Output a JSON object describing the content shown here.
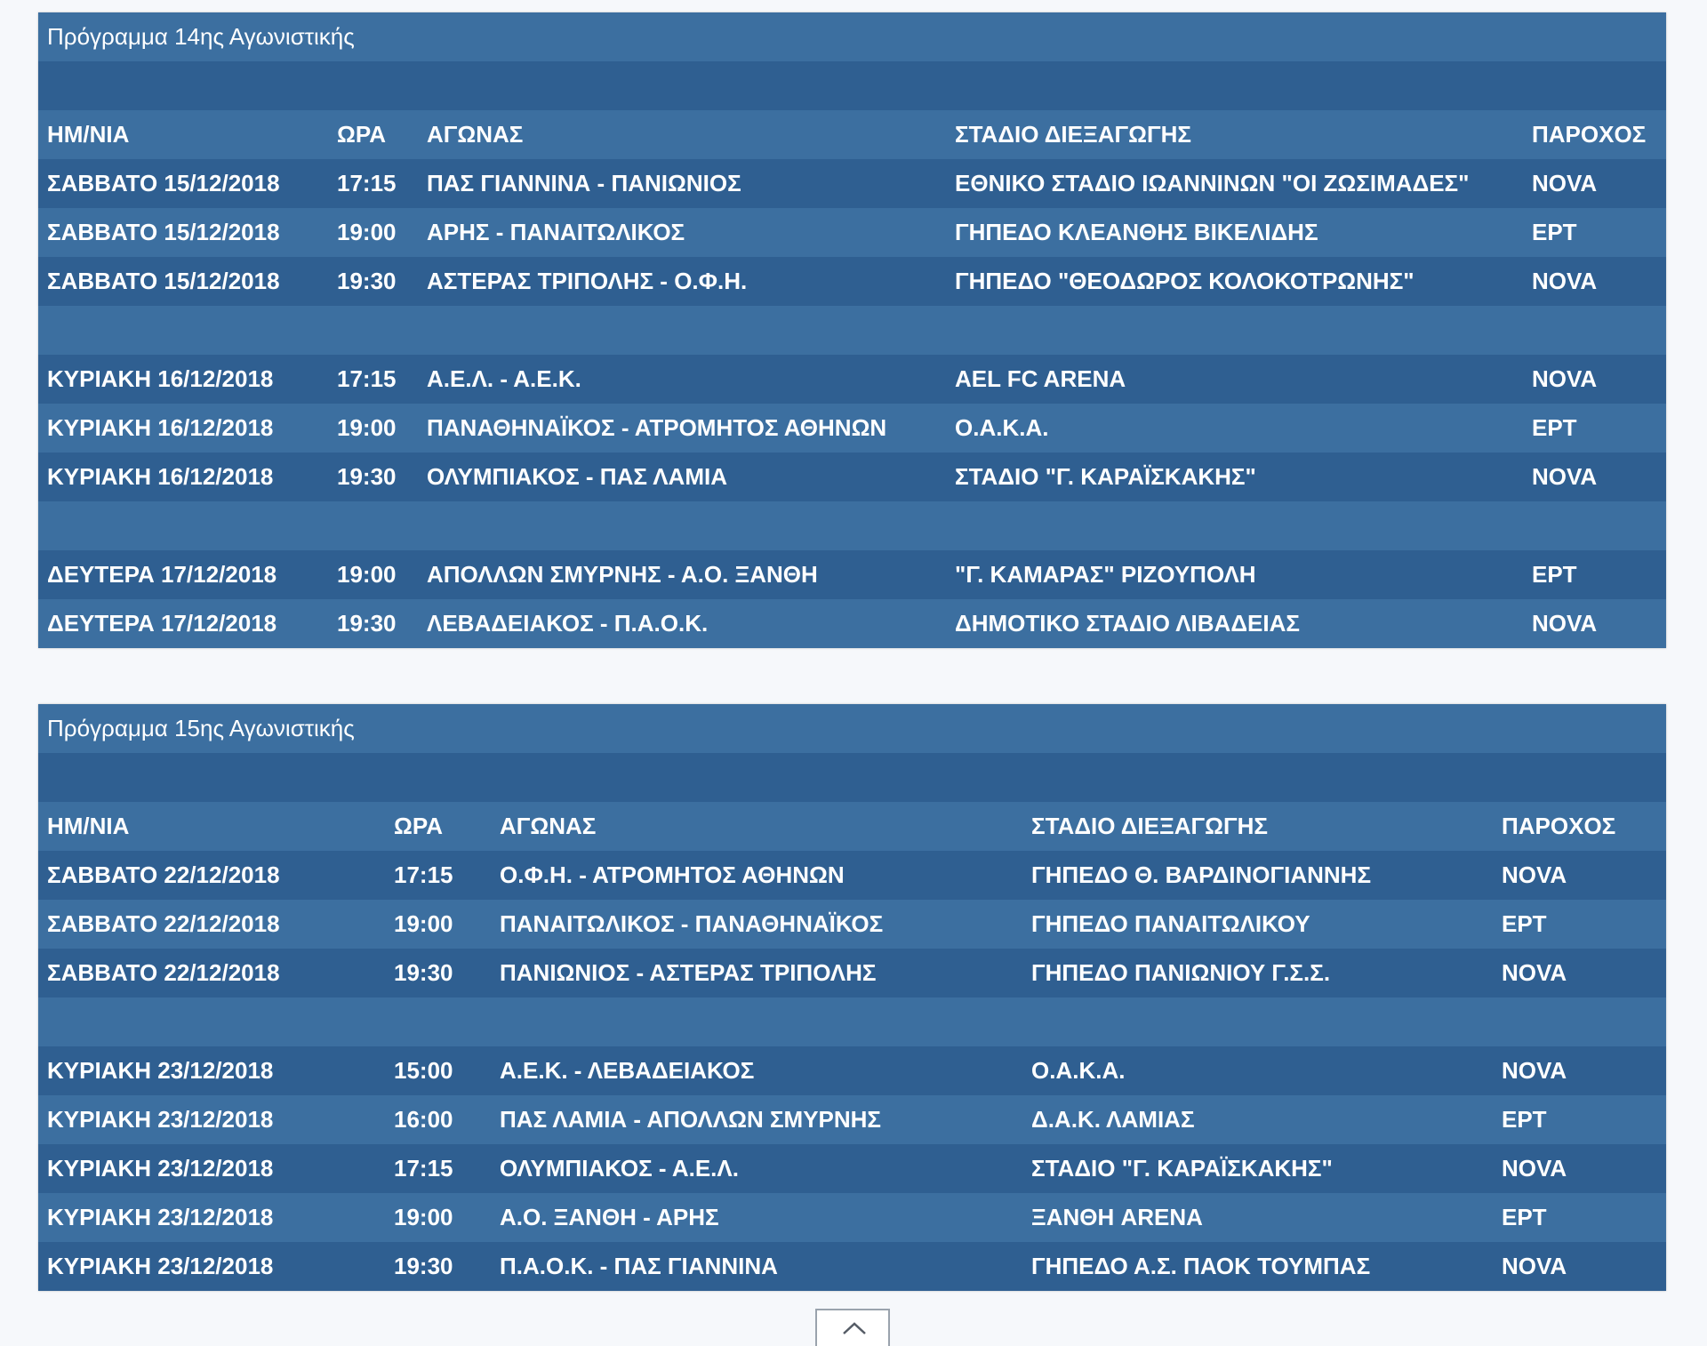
{
  "schedule14": {
    "title": "Πρόγραμμα 14ης Αγωνιστικής",
    "headers": [
      "ΗΜ/ΝΙΑ",
      "ΩΡΑ",
      "ΑΓΩΝΑΣ",
      "ΣΤΑΔΙΟ ΔΙΕΞΑΓΩΓΗΣ",
      "ΠΑΡΟΧΟΣ"
    ],
    "rows": [
      [
        "ΣΑΒΒΑΤΟ 15/12/2018",
        "17:15",
        "ΠΑΣ ΓΙΑΝΝΙΝΑ - ΠΑΝΙΩΝΙΟΣ",
        "ΕΘΝΙΚΟ ΣΤΑΔΙΟ ΙΩΑΝΝΙΝΩΝ \"ΟΙ ΖΩΣΙΜΑΔΕΣ\"",
        "NOVA"
      ],
      [
        "ΣΑΒΒΑΤΟ 15/12/2018",
        "19:00",
        "ΑΡΗΣ - ΠΑΝΑΙΤΩΛΙΚΟΣ",
        "ΓΗΠΕΔΟ ΚΛΕΑΝΘΗΣ ΒΙΚΕΛΙΔΗΣ",
        "ΕΡΤ"
      ],
      [
        "ΣΑΒΒΑΤΟ 15/12/2018",
        "19:30",
        "ΑΣΤΕΡΑΣ ΤΡΙΠΟΛΗΣ - Ο.Φ.Η.",
        "ΓΗΠΕΔΟ \"ΘΕΟΔΩΡΟΣ ΚΟΛΟΚΟΤΡΩΝΗΣ\"",
        "NOVA"
      ],
      [
        "ΚΥΡΙΑΚΗ 16/12/2018",
        "17:15",
        "Α.Ε.Λ. - Α.Ε.Κ.",
        "AEL FC ARENA",
        "NOVA"
      ],
      [
        "ΚΥΡΙΑΚΗ 16/12/2018",
        "19:00",
        "ΠΑΝΑΘΗΝΑΪΚΟΣ - ΑΤΡΟΜΗΤΟΣ ΑΘΗΝΩΝ",
        "Ο.Α.Κ.Α.",
        "ΕΡΤ"
      ],
      [
        "ΚΥΡΙΑΚΗ 16/12/2018",
        "19:30",
        "ΟΛΥΜΠΙΑΚΟΣ - ΠΑΣ ΛΑΜΙΑ",
        "ΣΤΑΔΙΟ \"Γ. ΚΑΡΑΪΣΚΑΚΗΣ\"",
        "NOVA"
      ],
      [
        "ΔΕΥΤΕΡΑ 17/12/2018",
        "19:00",
        "ΑΠΟΛΛΩΝ ΣΜΥΡΝΗΣ - Α.Ο. ΞΑΝΘΗ",
        "\"Γ. ΚΑΜΑΡΑΣ\" ΡΙΖΟΥΠΟΛΗ",
        "ΕΡΤ"
      ],
      [
        "ΔΕΥΤΕΡΑ 17/12/2018",
        "19:30",
        "ΛΕΒΑΔΕΙΑΚΟΣ - Π.Α.Ο.Κ.",
        "ΔΗΜΟΤΙΚΟ ΣΤΑΔΙΟ ΛΙΒΑΔΕΙΑΣ",
        "NOVA"
      ]
    ]
  },
  "schedule15": {
    "title": "Πρόγραμμα 15ης Αγωνιστικής",
    "headers": [
      "ΗΜ/ΝΙΑ",
      "ΩΡΑ",
      "ΑΓΩΝΑΣ",
      "ΣΤΑΔΙΟ ΔΙΕΞΑΓΩΓΗΣ",
      "ΠΑΡΟΧΟΣ"
    ],
    "rows": [
      [
        "ΣΑΒΒΑΤΟ 22/12/2018",
        "17:15",
        "Ο.Φ.Η. - ΑΤΡΟΜΗΤΟΣ ΑΘΗΝΩΝ",
        "ΓΗΠΕΔΟ Θ. ΒΑΡΔΙΝΟΓΙΑΝΝΗΣ",
        "NOVA"
      ],
      [
        "ΣΑΒΒΑΤΟ 22/12/2018",
        "19:00",
        "ΠΑΝΑΙΤΩΛΙΚΟΣ - ΠΑΝΑΘΗΝΑΪΚΟΣ",
        "ΓΗΠΕΔΟ ΠΑΝΑΙΤΩΛΙΚΟΥ",
        "ΕΡΤ"
      ],
      [
        "ΣΑΒΒΑΤΟ 22/12/2018",
        "19:30",
        "ΠΑΝΙΩΝΙΟΣ - ΑΣΤΕΡΑΣ ΤΡΙΠΟΛΗΣ",
        "ΓΗΠΕΔΟ ΠΑΝΙΩΝΙΟΥ Γ.Σ.Σ.",
        "NOVA"
      ],
      [
        "ΚΥΡΙΑΚΗ 23/12/2018",
        "15:00",
        "Α.Ε.Κ. - ΛΕΒΑΔΕΙΑΚΟΣ",
        "Ο.Α.Κ.Α.",
        "NOVA"
      ],
      [
        "ΚΥΡΙΑΚΗ 23/12/2018",
        "16:00",
        "ΠΑΣ ΛΑΜΙΑ - ΑΠΟΛΛΩΝ ΣΜΥΡΝΗΣ",
        "Δ.Α.Κ. ΛΑΜΙΑΣ",
        "ΕΡΤ"
      ],
      [
        "ΚΥΡΙΑΚΗ 23/12/2018",
        "17:15",
        "ΟΛΥΜΠΙΑΚΟΣ - Α.Ε.Λ.",
        "ΣΤΑΔΙΟ \"Γ. ΚΑΡΑΪΣΚΑΚΗΣ\"",
        "NOVA"
      ],
      [
        "ΚΥΡΙΑΚΗ 23/12/2018",
        "19:00",
        "Α.Ο. ΞΑΝΘΗ - ΑΡΗΣ",
        "ΞΑΝΘΗ ARENA",
        "ΕΡΤ"
      ],
      [
        "ΚΥΡΙΑΚΗ 23/12/2018",
        "19:30",
        "Π.Α.Ο.Κ. - ΠΑΣ ΓΙΑΝΝΙΝΑ",
        "ΓΗΠΕΔΟ Α.Σ. ΠΑΟΚ ΤΟΥΜΠΑΣ",
        "NOVA"
      ]
    ]
  },
  "scroll_top": {
    "icon": "chevron-up-icon"
  }
}
